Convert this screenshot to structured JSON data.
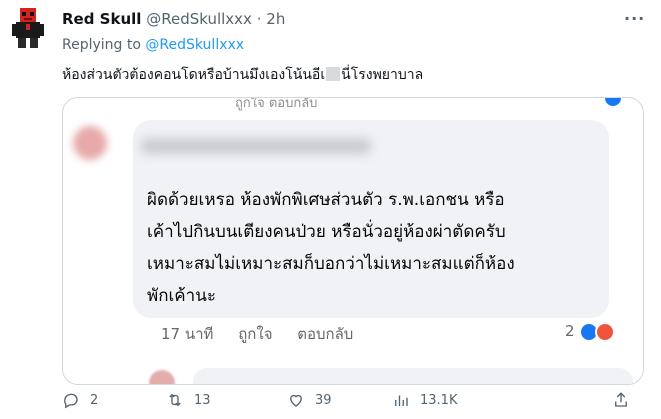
{
  "tweet": {
    "author_name": "Red Skull",
    "handle": "@RedSkullxxx",
    "separator": "·",
    "time": "2h",
    "more_label": "···",
    "replying_prefix": "Replying to",
    "replying_to": "@RedSkullxxx",
    "text_part1": "ห้องส่วนตัวต้องคอนโดหรือบ้านมึงเองโน้นอีเ",
    "text_part2": "นี่โรงพยาบาล"
  },
  "media": {
    "top_strip": "ถูกใจ     ตอบกลับ",
    "comment_lines": [
      "ผิดด้วยเหรอ ห้องพักพิเศษส่วนตัว ร.พ.เอกชน หรือ",
      "เค้าไปกินบนเตียงคนป่วย หรือนั่วอยู่ห้องผ่าตัดครับ",
      "เหมาะสมไม่เหมาะสมก็บอกว่าไม่เหมาะสมแต่ก็ห้อง",
      "พักเค้านะ"
    ],
    "comment_time": "17 นาที",
    "like_label": "ถูกใจ",
    "reply_label": "ตอบกลับ",
    "reaction_count": "2"
  },
  "actions": {
    "reply_count": "2",
    "retweet_count": "13",
    "like_count": "39",
    "view_count": "13.1K"
  },
  "colors": {
    "accent": "#1d9bf0",
    "muted": "#536471",
    "bubble": "#f0f2f5",
    "like_blue": "#1877f2",
    "angry": "#f0543c"
  }
}
